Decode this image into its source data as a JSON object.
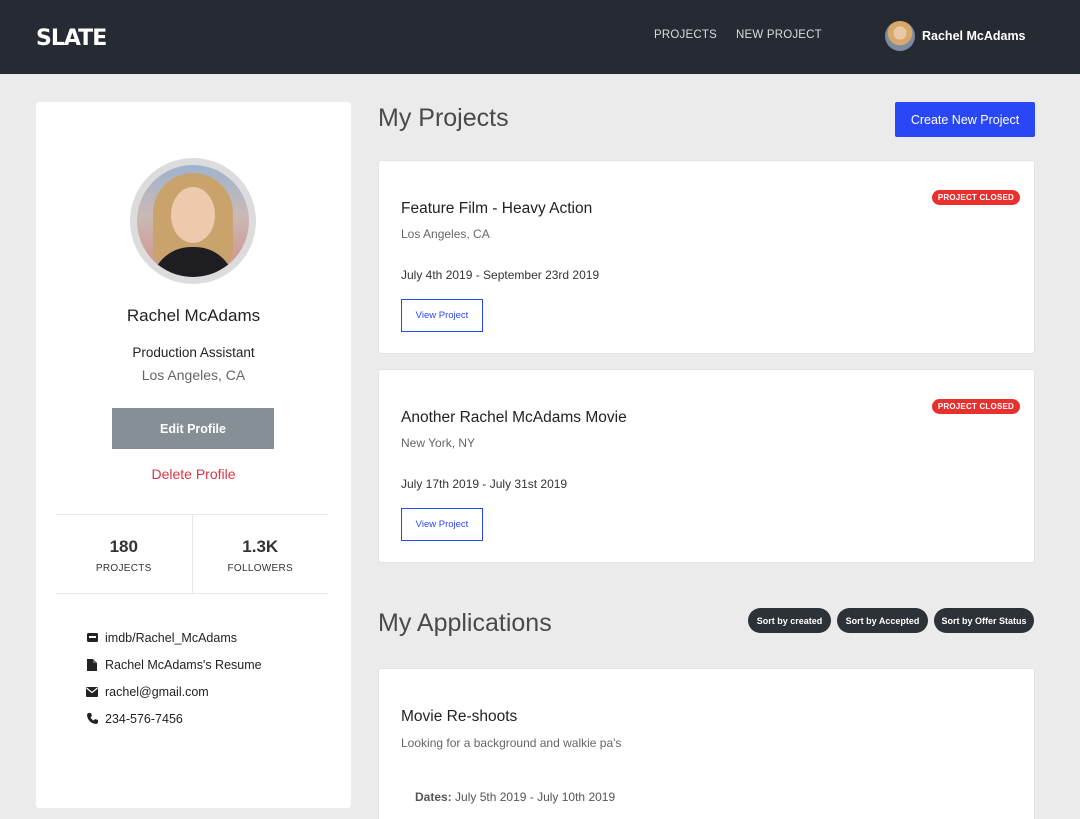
{
  "nav": {
    "logo": "SLATE",
    "links": [
      "PROJECTS",
      "NEW PROJECT"
    ],
    "username": "Rachel McAdams"
  },
  "profile": {
    "name": "Rachel McAdams",
    "role": "Production Assistant",
    "location": "Los Angeles, CA",
    "edit_label": "Edit Profile",
    "delete_label": "Delete Profile",
    "stats": [
      {
        "value": "180",
        "label": "PROJECTS"
      },
      {
        "value": "1.3K",
        "label": "FOLLOWERS"
      }
    ],
    "contact": [
      {
        "icon": "imdb-icon",
        "text": "imdb/Rachel_McAdams"
      },
      {
        "icon": "document-icon",
        "text": "Rachel McAdams's Resume"
      },
      {
        "icon": "envelope-icon",
        "text": "rachel@gmail.com"
      },
      {
        "icon": "phone-icon",
        "text": "234-576-7456"
      }
    ]
  },
  "projects": {
    "title": "My Projects",
    "create_label": "Create New Project",
    "items": [
      {
        "title": "Feature Film - Heavy Action",
        "location": "Los Angeles, CA",
        "dates": "July 4th 2019 - September 23rd 2019",
        "status": "PROJECT CLOSED",
        "button": "View Project"
      },
      {
        "title": "Another Rachel McAdams Movie",
        "location": "New York, NY",
        "dates": "July 17th 2019 - July 31st 2019",
        "status": "PROJECT CLOSED",
        "button": "View Project"
      }
    ]
  },
  "applications": {
    "title": "My Applications",
    "sort_buttons": [
      "Sort by created",
      "Sort by Accepted",
      "Sort by Offer Status"
    ],
    "items": [
      {
        "title": "Movie Re-shoots",
        "description": "Looking for a background and walkie pa's",
        "dates_label": "Dates:",
        "dates": "July 5th 2019 - July 10th 2019"
      }
    ]
  },
  "colors": {
    "navbar": "#262a33",
    "primary": "#2a47f5",
    "danger": "#dc3545",
    "badge": "#e8302f"
  }
}
